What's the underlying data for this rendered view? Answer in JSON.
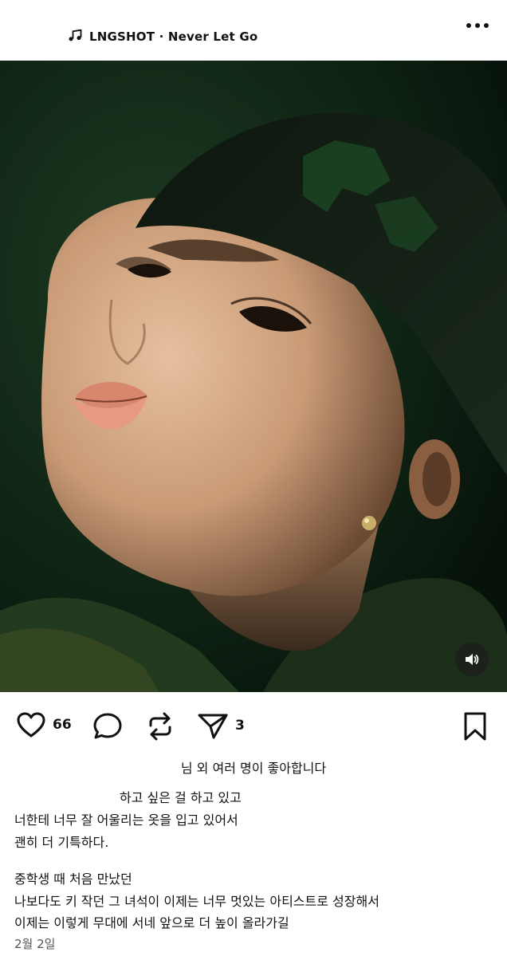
{
  "music": {
    "artist": "LNGSHOT",
    "separator": "·",
    "song": "Never Let Go",
    "label": "LNGSHOT · Never Let Go",
    "icon": "music-note-icon"
  },
  "header": {
    "more_icon": "more-horizontal-icon"
  },
  "post": {
    "media_alt": "portrait-photo",
    "mute_icon": "speaker-icon"
  },
  "actions": {
    "like_count": "66",
    "share_count": "3"
  },
  "liked_by": "님 외 여러 명이 좋아합니다",
  "caption_lines": [
    "하고 싶은 걸 하고 있고",
    "너한테 너무 잘 어울리는 옷을 입고 있어서",
    "괜히 더 기특하다.",
    "",
    "중학생 때 처음 만났던",
    "나보다도 키 작던 그 녀석이  이제는 너무 멋있는 아티스트로 성장해서",
    "이제는 이렇게 무대에 서네 앞으로 더 높이 올라가길"
  ],
  "date": "2월 2일",
  "colors": {
    "photo_dark": "#0b1a10",
    "accent_green": "#2e5a34"
  }
}
